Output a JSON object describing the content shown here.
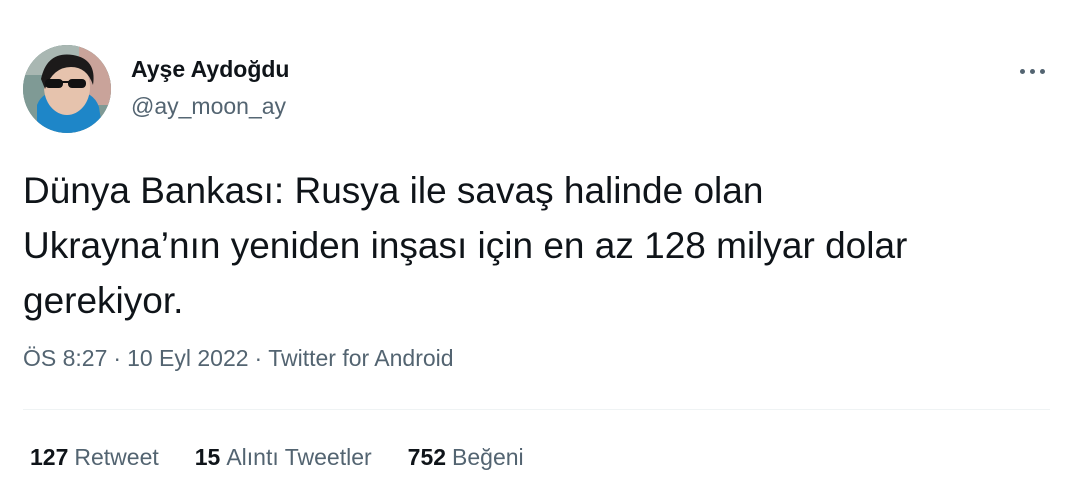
{
  "user": {
    "display_name": "Ayşe Aydoğdu",
    "handle": "@ay_moon_ay"
  },
  "tweet": {
    "text": "Dünya Bankası: Rusya ile savaş halinde olan\nUkrayna’nın yeniden inşası için en az 128 milyar dolar\ngerekiyor.",
    "time": "ÖS 8:27",
    "date": "10 Eyl 2022",
    "source": "Twitter for Android",
    "separator": "·"
  },
  "stats": {
    "retweets_count": "127",
    "retweets_label": "Retweet",
    "quotes_count": "15",
    "quotes_label": "Alıntı Tweetler",
    "likes_count": "752",
    "likes_label": "Beğeni"
  },
  "icons": {
    "more": "more-horizontal-icon"
  },
  "colors": {
    "primary_text": "#0f1419",
    "secondary_text": "#536471",
    "divider": "#eff3f4"
  }
}
